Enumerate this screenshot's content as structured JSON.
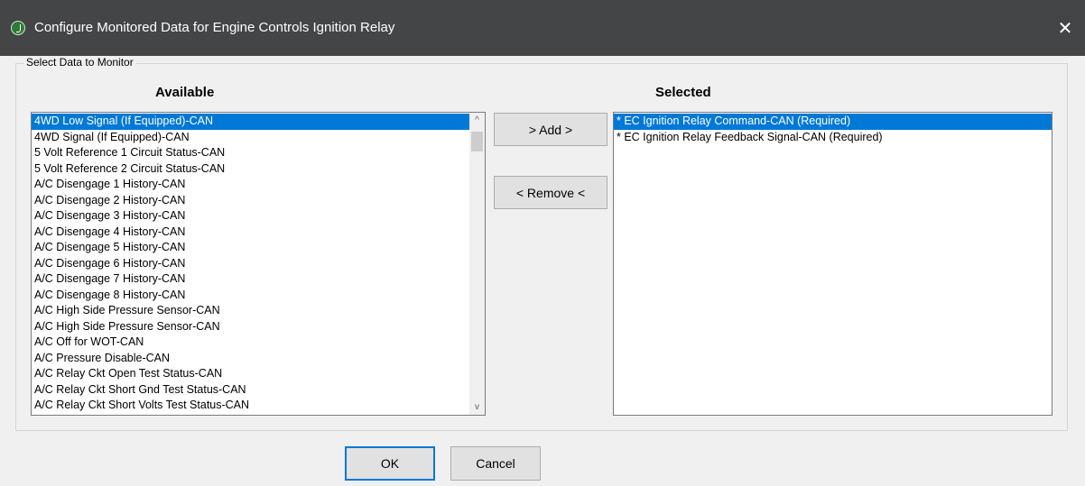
{
  "window": {
    "title": "Configure Monitored Data for Engine Controls Ignition Relay",
    "close_glyph": "✕"
  },
  "group": {
    "legend": "Select Data to Monitor"
  },
  "available": {
    "heading": "Available",
    "items": [
      "4WD Low Signal (If Equipped)-CAN",
      "4WD Signal (If Equipped)-CAN",
      "5 Volt Reference 1 Circuit Status-CAN",
      "5 Volt Reference 2 Circuit Status-CAN",
      "A/C Disengage 1 History-CAN",
      "A/C Disengage 2 History-CAN",
      "A/C Disengage 3 History-CAN",
      "A/C Disengage 4 History-CAN",
      "A/C Disengage 5 History-CAN",
      "A/C Disengage 6 History-CAN",
      "A/C Disengage 7 History-CAN",
      "A/C Disengage 8 History-CAN",
      "A/C High Side Pressure Sensor-CAN",
      "A/C High Side Pressure Sensor-CAN",
      "A/C Off for WOT-CAN",
      "A/C Pressure Disable-CAN",
      "A/C Relay Ckt Open Test Status-CAN",
      "A/C Relay Ckt Short Gnd Test Status-CAN",
      "A/C Relay Ckt Short Volts Test Status-CAN"
    ],
    "selected_index": 0,
    "scroll_up": "^",
    "scroll_down": "v"
  },
  "selected": {
    "heading": "Selected",
    "items": [
      "* EC Ignition Relay Command-CAN (Required)",
      "* EC Ignition Relay Feedback Signal-CAN (Required)"
    ],
    "selected_index": 0
  },
  "buttons": {
    "add": "> Add >",
    "remove": "< Remove <",
    "ok": "OK",
    "cancel": "Cancel"
  }
}
